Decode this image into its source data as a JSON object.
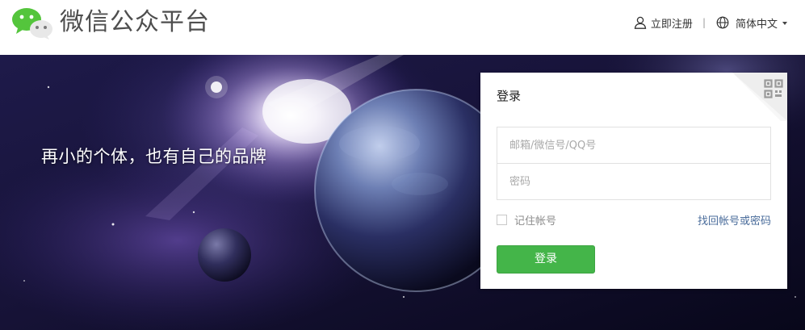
{
  "header": {
    "brand_title": "微信公众平台",
    "register_label": "立即注册",
    "separator": "|",
    "language_label": "简体中文",
    "logo_icon": "wechat-logo-icon",
    "user_icon": "user-icon",
    "globe_icon": "globe-icon"
  },
  "banner": {
    "slogan": "再小的个体，也有自己的品牌"
  },
  "login": {
    "title": "登录",
    "qr_icon": "qr-code-icon",
    "account_placeholder": "邮箱/微信号/QQ号",
    "password_placeholder": "密码",
    "remember_label": "记住帐号",
    "forgot_label": "找回帐号或密码",
    "submit_label": "登录"
  },
  "colors": {
    "brand_green": "#44b549",
    "link_blue": "#4a6c9b",
    "title_gray": "#4e4e4e"
  }
}
